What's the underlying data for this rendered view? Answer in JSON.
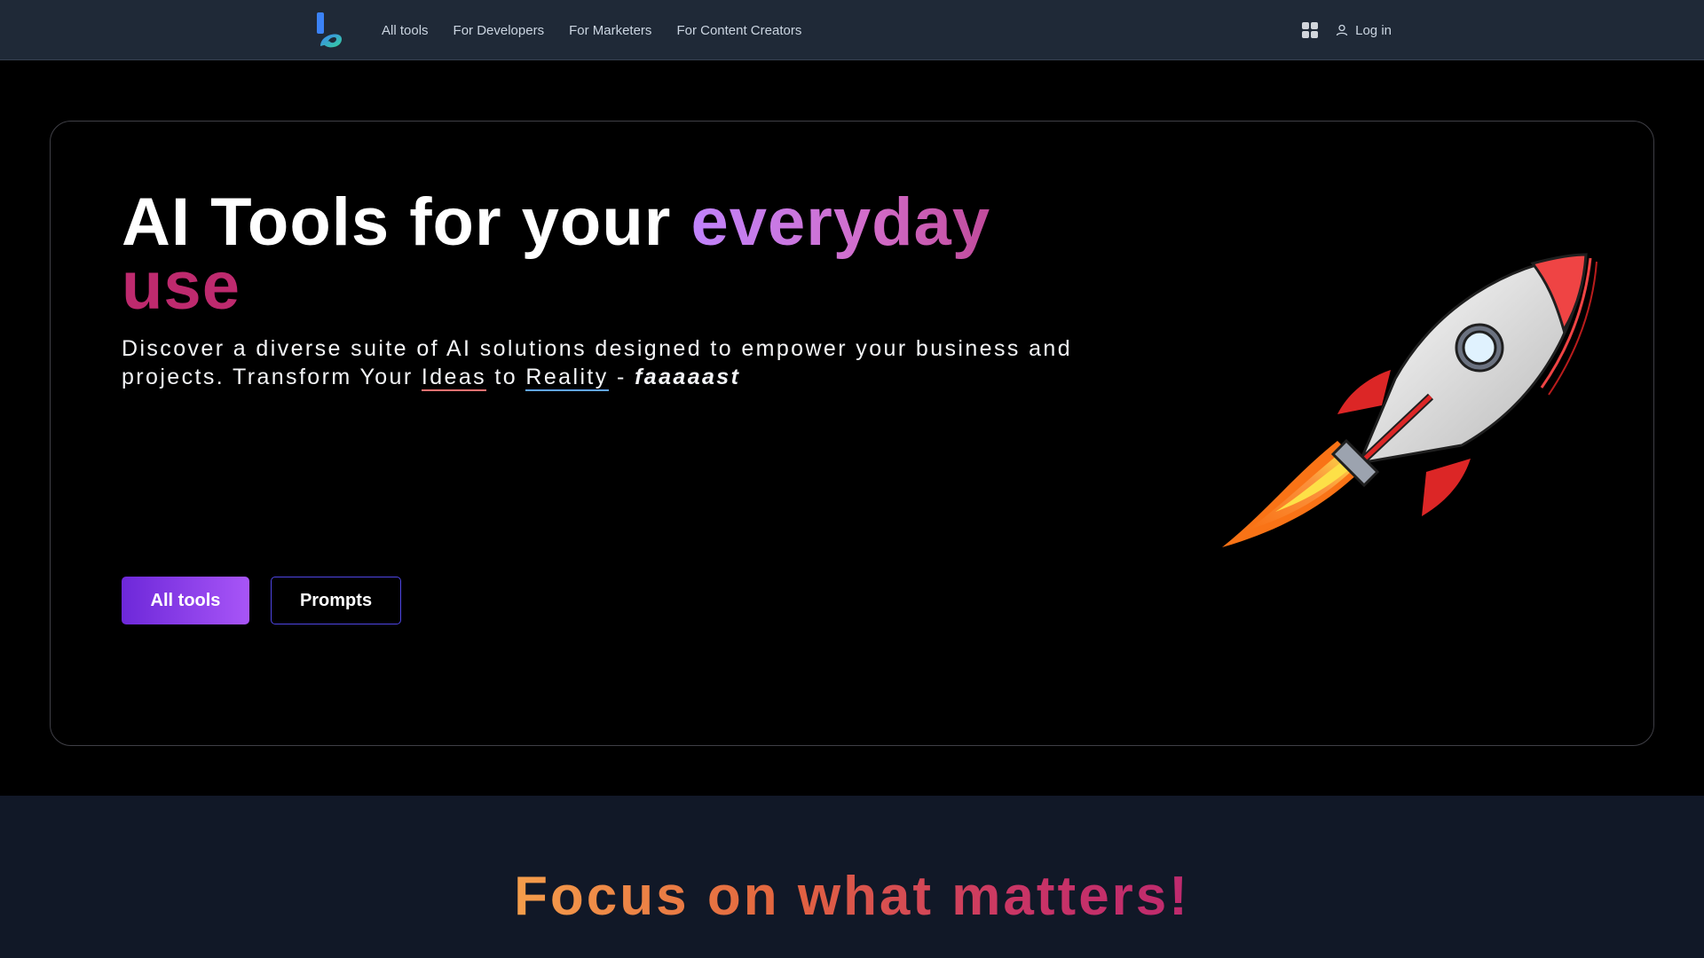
{
  "header": {
    "nav": [
      "All tools",
      "For Developers",
      "For Marketers",
      "For Content Creators"
    ],
    "login_label": "Log in"
  },
  "hero": {
    "title_part1": "AI Tools for your ",
    "title_highlight1": "everyday",
    "title_highlight2": "use",
    "desc_part1": "Discover a diverse suite of AI solutions designed to empower your business and projects. Transform Your ",
    "desc_ideas": "Ideas",
    "desc_to": " to ",
    "desc_reality": "Reality",
    "desc_dash": " - ",
    "desc_fast": "faaaaast",
    "btn_primary": "All tools",
    "btn_secondary": "Prompts"
  },
  "section2": {
    "title": "Focus on what matters!"
  },
  "colors": {
    "header_bg": "#1f2937",
    "accent_purple": "#a855f7",
    "accent_pink": "#be2a6e",
    "accent_orange": "#f59e4b"
  },
  "icons": [
    "logo-b-icon",
    "apps-grid-icon",
    "user-icon",
    "rocket-illustration"
  ]
}
